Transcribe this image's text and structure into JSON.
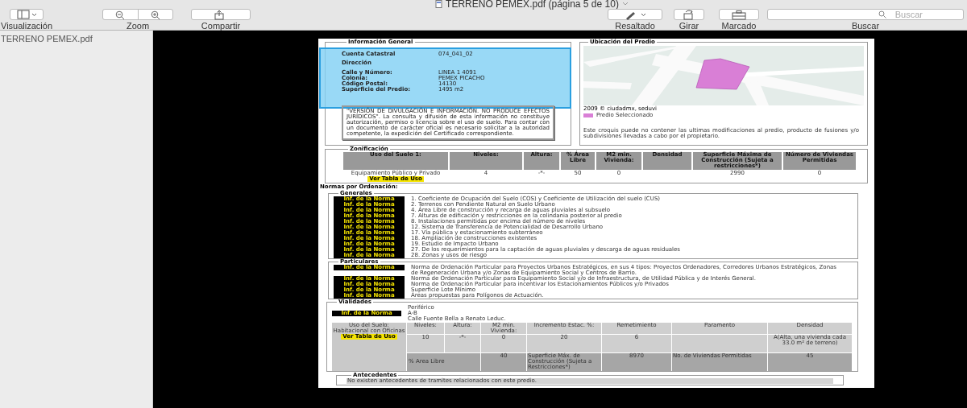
{
  "window": {
    "title": "TERRENO PEMEX.pdf (página 5 de 10)"
  },
  "toolbar": {
    "left": [
      {
        "kind": "sidebar",
        "label": "Visualización"
      },
      {
        "kind": "zoom",
        "label": "Zoom"
      },
      {
        "kind": "share",
        "label": "Compartir"
      }
    ],
    "right": [
      {
        "kind": "highlight",
        "label": "Resaltado"
      },
      {
        "kind": "rotate",
        "label": "Girar"
      },
      {
        "kind": "toolbox",
        "label": "Marcado"
      }
    ],
    "search": {
      "placeholder": "Buscar",
      "label": "Buscar"
    }
  },
  "sidebar": {
    "file": "TERRENO PEMEX.pdf"
  },
  "info_general": {
    "title": "Información General",
    "cuenta": {
      "label": "Cuenta Catastral",
      "value": "074_041_02"
    },
    "heading": "Dirección",
    "rows": [
      {
        "label": "Calle y Número:",
        "value": "LINEA 1 4091"
      },
      {
        "label": "Colonia:",
        "value": "PEMEX PICACHO"
      },
      {
        "label": "Código Postal:",
        "value": "14130"
      },
      {
        "label": "Superficie del Predio:",
        "value": "1495 m2"
      }
    ],
    "selected": true,
    "disclaimer": "\"VERSIÓN DE DIVULGACIÓN E INFORMACIÓN. NO PRODUCE EFECTOS JURÍDICOS\". La consulta y difusión de esta información no constituye autorización, permiso o licencia sobre el uso de suelo. Para contar con un documento de carácter oficial es necesario solicitar a la autoridad competente, la expedición del Certificado correspondiente."
  },
  "ubicacion": {
    "title": "Ubicación del Predio",
    "credit": "2009 © ciudadmx, seduvi",
    "legend": {
      "label": "Predio Seleccionado",
      "color": "#d97fd6"
    },
    "note": "Este croquis puede no contener las ultimas modificaciones al predio, producto de fusiones y/o subdivisiones llevadas a cabo por el propietario."
  },
  "zonificacion": {
    "title": "Zonificación",
    "uso_column": "Uso del Suelo 1:",
    "uso": "Equipamiento Público y Privado",
    "link": "Ver Tabla de Uso",
    "columns": [
      {
        "label": "Niveles:",
        "value": "4"
      },
      {
        "label": "Altura:",
        "value": "-*-"
      },
      {
        "label": "% Área Libre",
        "value": "50"
      },
      {
        "label": "M2 min. Vivienda:",
        "value": "0"
      },
      {
        "label": "Densidad"
      },
      {
        "label": "Superficie Máxima de Construcción (Sujeta a restricciones*)",
        "value": "2990"
      },
      {
        "label": "Número de Viviendas Permitidas",
        "value": "0"
      }
    ]
  },
  "normas": {
    "title": "Normas por Ordenación:",
    "generales": {
      "title": "Generales",
      "items": [
        {
          "link": "Inf. de la Norma",
          "text": "1. Coeficiente de Ocupación del Suelo (COS) y Coeficiente de Utilización del suelo (CUS)"
        },
        {
          "link": "Inf. de la Norma",
          "text": "2. Terrenos con Pendiente Natural en Suelo Urbano"
        },
        {
          "link": "Inf. de la Norma",
          "text": "4. Área Libre de construcción y recarga de aguas pluviales al subsuelo"
        },
        {
          "link": "Inf. de la Norma",
          "text": "7. Alturas de edificación y restricciones en la colindania posterior al predio"
        },
        {
          "link": "Inf. de la Norma",
          "text": "8. Instalaciones permitidas por encima del número de niveles"
        },
        {
          "link": "Inf. de la Norma",
          "text": "12. Sistema de Transferencia de Potencialidad de Desarrollo Urbano"
        },
        {
          "link": "Inf. de la Norma",
          "text": "17. Vía pública y estacionamiento subterráneo"
        },
        {
          "link": "Inf. de la Norma",
          "text": "18. Ampliación de construcciones existentes"
        },
        {
          "link": "Inf. de la Norma",
          "text": "19. Estudio de Impacto Urbano"
        },
        {
          "link": "Inf. de la Norma",
          "text": "27. De los requerimientos para la captación de aguas pluviales y descarga de aguas residuales"
        },
        {
          "link": "Inf. de la Norma",
          "text": "28. Zonas y usos de riesgo"
        }
      ]
    },
    "particulares": {
      "title": "Particulares",
      "items": [
        {
          "link": "Inf. de la Norma",
          "text": "Norma de Ordenación Particular para Proyectos Urbanos Estratégicos, en sus 4 tipos: Proyectos Ordenadores, Corredores Urbanos Estratégicos, Zonas de Regeneración Urbana y/o Zonas de Equipamiento Social y Centros de Barrio."
        },
        {
          "link": "Inf. de la Norma",
          "text": "Norma de Ordenación Particular para Equipamiento Social y/o de Infraestructura, de Utilidad Pública y de Interés General."
        },
        {
          "link": "Inf. de la Norma",
          "text": "Norma de Ordenación Particular para incentivar los Estacionamientos Públicos y/o Privados"
        },
        {
          "link": "Inf. de la Norma",
          "text": "Superficie Lote Mínimo"
        },
        {
          "link": "Inf. de la Norma",
          "text": "Áreas propuestas para Polígonos de Actuación."
        }
      ]
    }
  },
  "vialidades": {
    "title": "Vialidades",
    "link": "Inf. de la Norma",
    "lines": [
      "Periférico",
      "A-B",
      "Calle Fuente Bella a Renato Leduc."
    ],
    "uso": "Uso del Suelo: Habitacional con Oficinas",
    "uso_link": "Ver Tabla de Uso",
    "columns": [
      {
        "label": "Niveles:",
        "value": "10"
      },
      {
        "label": "Altura:",
        "value": "-*-"
      },
      {
        "label": "M2 min. Vivienda:",
        "value": "0"
      },
      {
        "label": "Incremento Estac. %:",
        "value": "20"
      },
      {
        "label": "Remetimiento",
        "value": "6"
      },
      {
        "label": "Paramento"
      },
      {
        "label": "Densidad",
        "value": "A(Alta, una vivienda cada 33.0 m² de terreno)"
      }
    ],
    "extra": [
      "% Area Libre",
      "40",
      "Superficie Máx. de Construcción (Sujeta a Restricciones*)",
      "8970",
      "No. de Viviendas Permitidas",
      "45"
    ]
  },
  "antecedentes": {
    "title": "Antecedentes",
    "text": "No existen antecedentes de tramites relacionados con este predio."
  }
}
